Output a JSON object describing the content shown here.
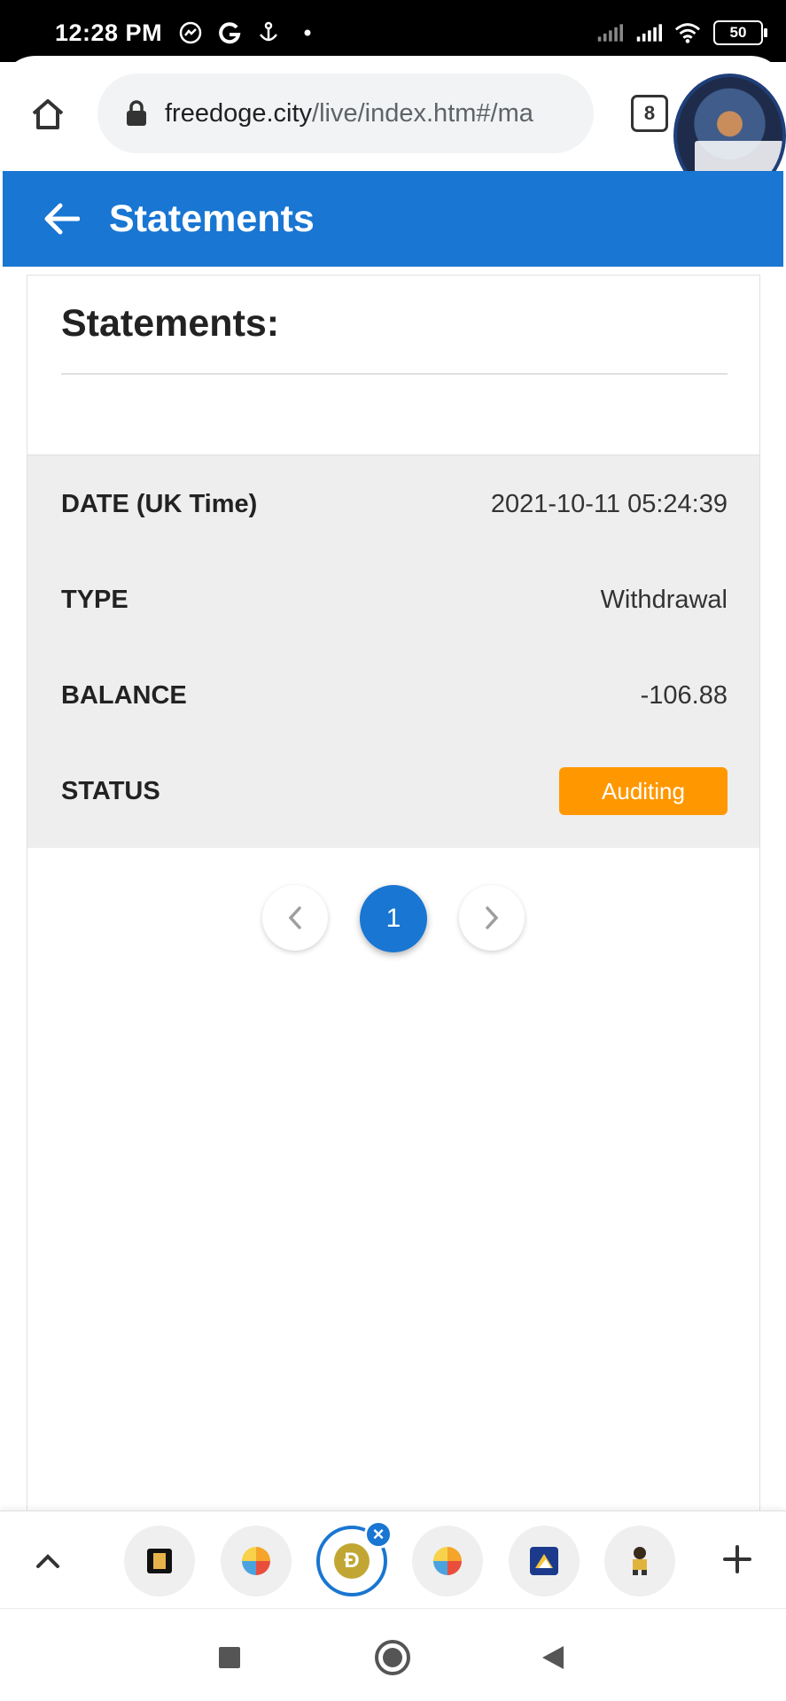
{
  "status_bar": {
    "time": "12:28 PM",
    "left_icons": [
      "messenger-icon",
      "google-icon",
      "anchor-icon",
      "dot-icon"
    ],
    "right_icons": [
      "signal-icon",
      "signal-icon",
      "wifi-icon",
      "battery-icon"
    ],
    "battery": "50"
  },
  "browser": {
    "url_domain": "freedoge.city",
    "url_path": "/live/index.htm#/ma",
    "tab_count": "8"
  },
  "header": {
    "title": "Statements",
    "color": "#1976d2"
  },
  "card": {
    "title": "Statements:",
    "rows": [
      {
        "label": "DATE (UK Time)",
        "value": "2021-10-11 05:24:39"
      },
      {
        "label": "TYPE",
        "value": "Withdrawal"
      },
      {
        "label": "BALANCE",
        "value": "-106.88"
      },
      {
        "label": "STATUS",
        "value": "Auditing"
      }
    ],
    "status_color": "#ff9800"
  },
  "pagination": {
    "prev": "‹",
    "current": "1",
    "next": "›"
  },
  "tab_strip": {
    "icons": [
      "expand-up-icon",
      "tab-favicon",
      "tab-favicon",
      "dogecoin-icon",
      "tab-favicon",
      "tab-favicon",
      "tab-favicon",
      "add-tab-icon"
    ],
    "active_letter": "Đ",
    "close": "×"
  },
  "nav_bar": {
    "icons": [
      "recents-icon",
      "home-icon",
      "back-icon"
    ]
  }
}
